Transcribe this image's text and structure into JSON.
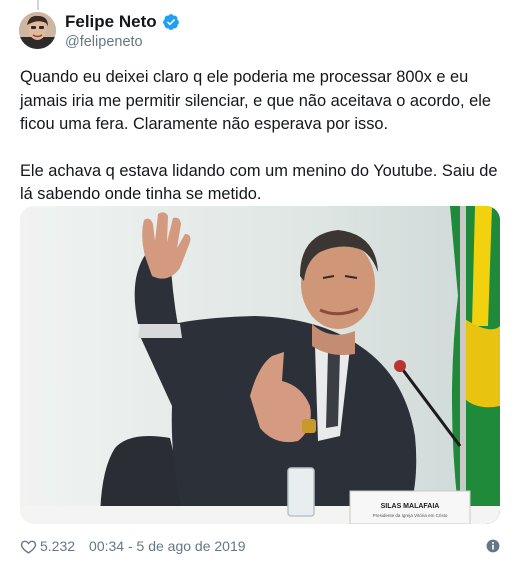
{
  "author": {
    "display_name": "Felipe Neto",
    "handle": "@felipeneto",
    "verified_icon": "verified-badge-icon"
  },
  "tweet": {
    "paragraph_1": "Quando eu deixei claro q ele poderia me processar 800x e eu jamais iria me permitir silenciar, e que não aceitava o acordo, ele ficou uma fera. Claramente não esperava por isso.",
    "paragraph_2": "Ele achava q estava lidando com um menino do Youtube. Saiu de lá sabendo onde tinha se metido.",
    "media": {
      "placard_name": "SILAS MALAFAIA",
      "placard_subtitle": "Presidente da Igreja Vitória em Cristo"
    }
  },
  "footer": {
    "like_count": "5.232",
    "timestamp": "00:34 - 5 de ago de 2019",
    "like_icon": "heart-icon",
    "info_icon": "info-icon"
  },
  "colors": {
    "verified": "#1da1f2",
    "secondary_text": "#657786",
    "primary_text": "#14171a"
  }
}
